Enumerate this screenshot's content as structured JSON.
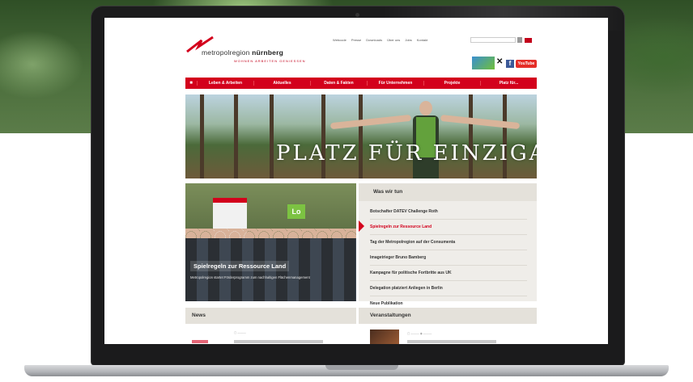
{
  "logo": {
    "brand_light": "metropolregion",
    "brand_bold": "nürnberg",
    "tagline": "WOHNEN ARBEITEN GENIESSEN"
  },
  "topnav": [
    "Webcode",
    "Presse",
    "Downloads",
    "Über uns",
    "Jobs",
    "Kontakt"
  ],
  "search": {
    "placeholder": ""
  },
  "social": {
    "youtube_label": "YouTube",
    "facebook_label": "f"
  },
  "mainnav": {
    "home_icon": "home-icon",
    "items": [
      "Leben & Arbeiten",
      "Aktuelles",
      "Daten & Fakten",
      "Für Unternehmen",
      "Projekte",
      "Platz für..."
    ]
  },
  "hero": {
    "text": "PLATZ FÜR EINZIGARTIGE"
  },
  "teaser": {
    "title": "Spielregeln zur Ressource Land",
    "description": "Metropolregion startet Förderprogramm zum nachhaltigen Flächenmanagement",
    "sign_text": "Lo"
  },
  "what_we_do": {
    "heading": "Was wir tun",
    "items": [
      "Botschafter DATEV Challenge Roth",
      "Spielregeln zur Ressource Land",
      "Tag der Metropolregion auf der Consumenta",
      "Imagetrieger Bruno Bamberg",
      "Kampagne für politische Fortbritte aus UK",
      "Delegation platziert Anliegen in Berlin",
      "Neue Publikation"
    ],
    "active_index": 1
  },
  "news": {
    "heading": "News"
  },
  "events": {
    "heading": "Veranstaltungen"
  },
  "colors": {
    "brand_red": "#d3001c",
    "panel": "#efede9"
  }
}
